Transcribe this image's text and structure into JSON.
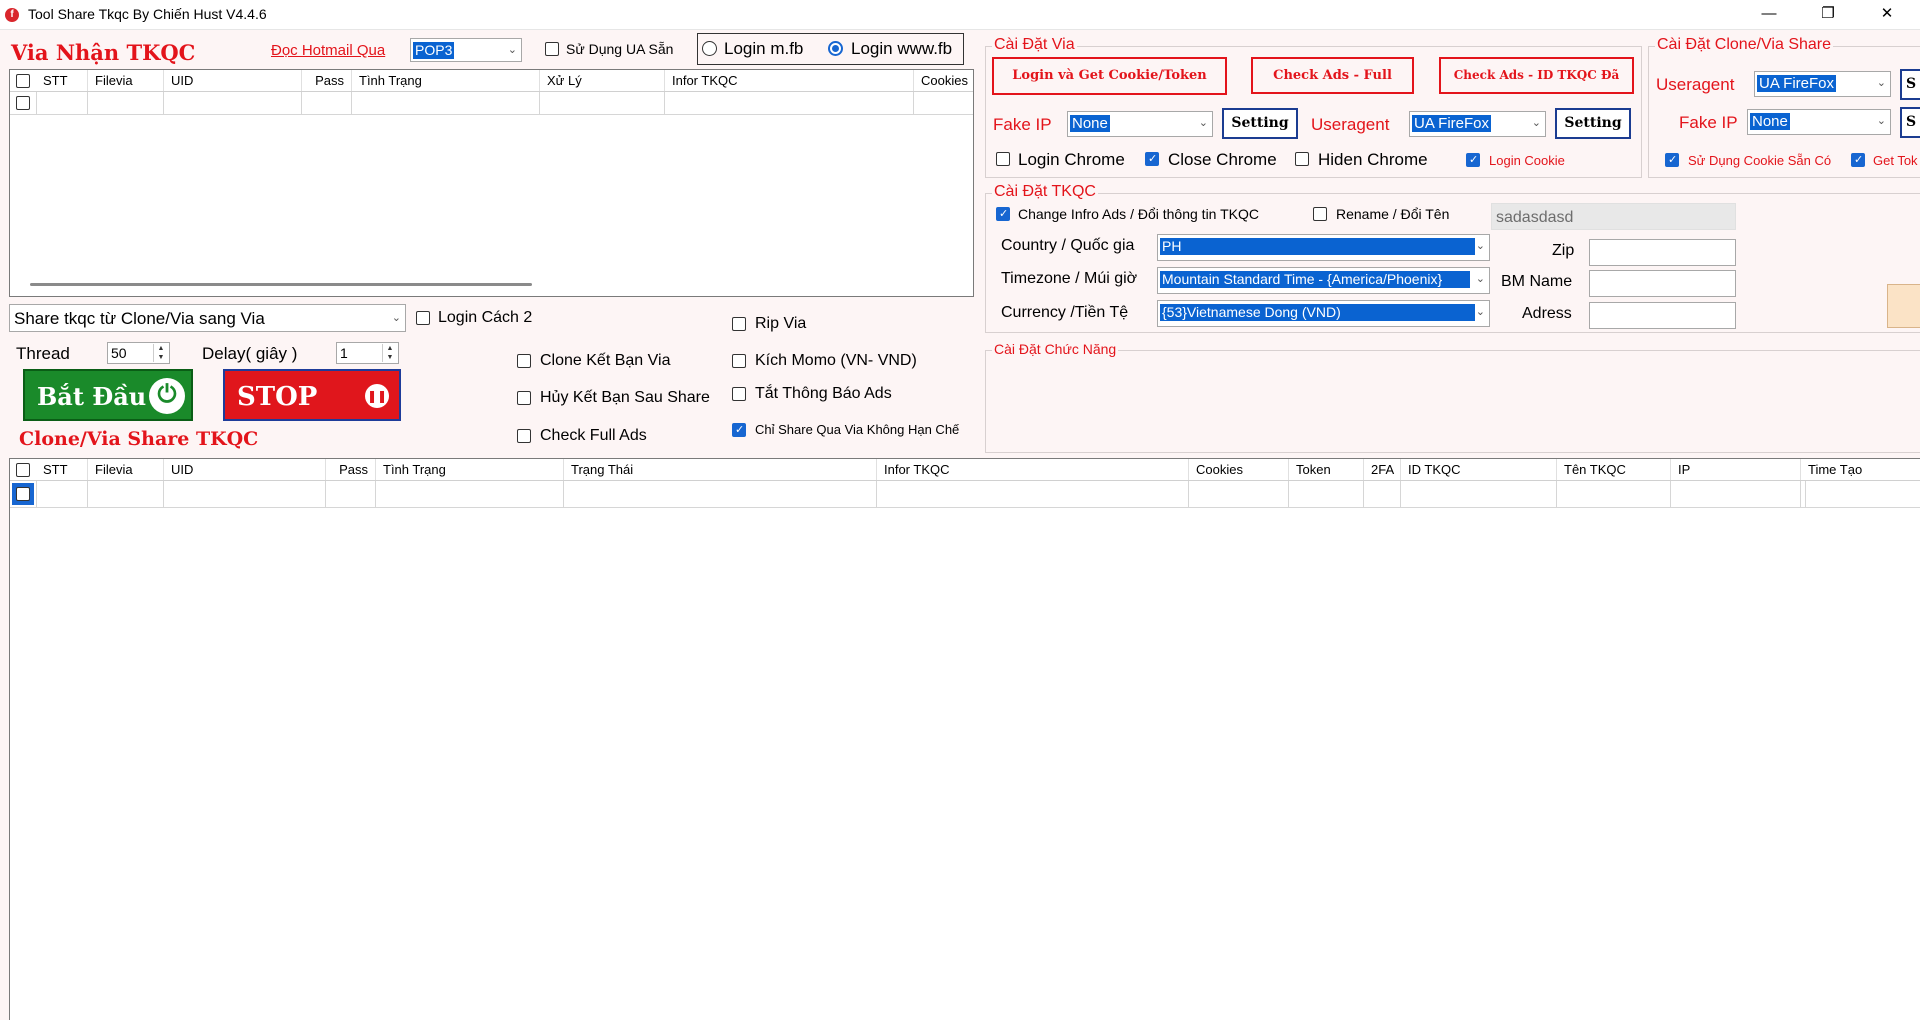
{
  "window": {
    "title": "Tool Share Tkqc By Chiến Hust V4.4.6",
    "icon_letter": "f",
    "minimize": "—",
    "restore": "❐",
    "close": "✕"
  },
  "top_left": {
    "heading": "Via Nhận TKQC",
    "read_hotmail_link": "Đọc Hotmail Qua",
    "protocol_select": "POP3",
    "use_ua_label": "Sử Dụng UA Sẵn",
    "login_mfb": "Login m.fb",
    "login_wwwfb": "Login www.fb"
  },
  "via_grid": {
    "columns": [
      "STT",
      "Filevia",
      "UID",
      "Pass",
      "Tình Trạng",
      "Xử Lý",
      "Infor TKQC",
      "Cookies"
    ]
  },
  "mode_select": "Share tkqc từ Clone/Via sang Via",
  "login_cach2": "Login Cách 2",
  "thread_label": "Thread",
  "thread_value": "50",
  "delay_label": "Delay( giây )",
  "delay_value": "1",
  "start_label": "Bắt Đầu",
  "stop_label": "STOP",
  "clone_heading": "Clone/Via Share TKQC",
  "options": {
    "clone_ket_ban_via": "Clone Kết Bạn Via",
    "huy_ket_ban": "Hủy Kết Bạn Sau Share",
    "check_full_ads": "Check Full Ads",
    "rip_via": "Rip Via",
    "kich_momo": "Kích Momo (VN- VND)",
    "tat_thong_bao": "Tắt Thông Báo Ads",
    "chi_share": "Chỉ Share Qua Via Không Hạn Chế"
  },
  "cai_dat_via": {
    "title": "Cài Đặt Via",
    "btn_login_cookie": "Login và Get Cookie/Token",
    "btn_check_full": "Check Ads - Full",
    "btn_check_id": "Check Ads - ID TKQC Đã",
    "fake_ip_label": "Fake IP",
    "fake_ip_value": "None",
    "setting1": "Setting",
    "useragent_label": "Useragent",
    "useragent_value": "UA FireFox",
    "setting2": "Setting",
    "login_chrome": "Login Chrome",
    "close_chrome": "Close Chrome",
    "hiden_chrome": "Hiden Chrome",
    "login_cookie": "Login Cookie"
  },
  "cai_dat_clone": {
    "title": "Cài Đặt Clone/Via Share",
    "useragent_label": "Useragent",
    "useragent_value": "UA FireFox",
    "fake_ip_label": "Fake IP",
    "fake_ip_value": "None",
    "btn_s1": "S",
    "btn_s2": "S",
    "use_cookie": "Sử Dụng Cookie Sẵn Có",
    "get_token": "Get Tok"
  },
  "cai_dat_tkqc": {
    "title": "Cài Đặt TKQC",
    "change_info": "Change Infro Ads / Đổi thông tin TKQC",
    "rename": "Rename / Đổi Tên",
    "rename_value": "sadasdasd",
    "country_label": "Country / Quốc gia",
    "country_value": "PH",
    "timezone_label": "Timezone / Múi giờ",
    "timezone_value": "Mountain Standard Time - {America/Phoenix}",
    "currency_label": "Currency /Tiền Tệ",
    "currency_value": "{53}Vietnamese Dong (VND)",
    "zip_label": "Zip",
    "bm_label": "BM Name",
    "address_label": "Adress"
  },
  "cai_dat_chuc_nang": {
    "title": "Cài Đặt Chức Năng"
  },
  "share_grid": {
    "columns": [
      "STT",
      "Filevia",
      "UID",
      "Pass",
      "Tình Trạng",
      "Trạng Thái",
      "Infor TKQC",
      "Cookies",
      "Token",
      "2FA",
      "ID TKQC",
      "Tên TKQC",
      "IP",
      "Time Tạo"
    ]
  }
}
